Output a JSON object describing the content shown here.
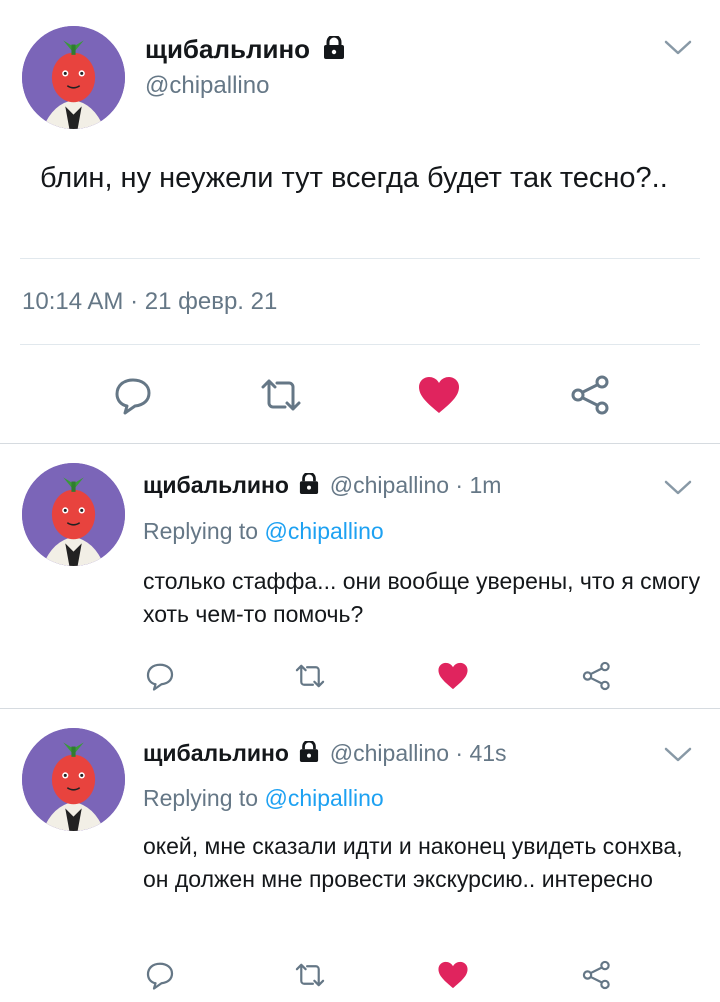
{
  "main_tweet": {
    "name": "щибальлино",
    "handle": "@chipallino",
    "text": "блин, ну неужели тут всегда будет так тесно?..",
    "timestamp": "10:14 AM · 21 февр. 21"
  },
  "replies": [
    {
      "name": "щибальлино",
      "handle": "@chipallino",
      "time": "· 1m",
      "replying_prefix": "Replying to",
      "replying_to": "@chipallino",
      "text": "столько стаффа... они вообще уверены, что я смогу хоть чем-то помочь?"
    },
    {
      "name": "щибальлино",
      "handle": "@chipallino",
      "time": "· 41s",
      "replying_prefix": "Replying to",
      "replying_to": "@chipallino",
      "text": "окей, мне сказали идти и наконец увидеть сонхва, он должен мне провести экскурсию.. интересно"
    }
  ],
  "icons": [
    "lock-icon",
    "chevron-down-icon",
    "reply-icon",
    "retweet-icon",
    "like-icon",
    "share-icon"
  ],
  "colors": {
    "like": "#e0245e",
    "link": "#1da1f2",
    "muted": "#657786",
    "avatar_bg": "#7b65b8"
  }
}
